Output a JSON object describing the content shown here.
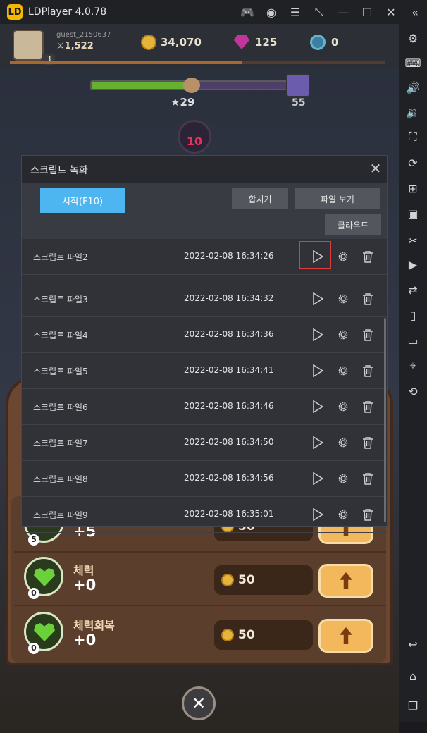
{
  "window": {
    "title": "LDPlayer 4.0.78",
    "logo_text": "LD",
    "titlebar_icons": [
      "gamepad-icon",
      "user-icon",
      "menu-icon",
      "resize-icon",
      "minimize-icon",
      "maximize-icon",
      "close-icon",
      "back-icon"
    ]
  },
  "sidebar": {
    "icons": [
      "settings-icon",
      "keyboard-icon",
      "volume-up-icon",
      "volume-down-icon",
      "screenshot-icon",
      "record-icon",
      "add-app-icon",
      "apk-icon",
      "scissors-icon",
      "video-icon",
      "sync-icon",
      "shake-icon",
      "folder-icon",
      "location-icon",
      "rotate-icon"
    ],
    "bottom_icons": [
      "back-icon",
      "home-icon",
      "recent-apps-icon"
    ]
  },
  "game": {
    "username": "guest_2150637",
    "power": "⚔1,522",
    "level": "3",
    "coins": "34,070",
    "gems": "125",
    "tokens": "0",
    "xp_progress": 0.62,
    "stage_current": "★29",
    "stage_max": "55",
    "stage_progress": 0.46,
    "bomb_count": "10",
    "stats": [
      {
        "name": "",
        "value": "+5",
        "level": "5",
        "cost": "50"
      },
      {
        "name": "체력",
        "value": "+0",
        "level": "0",
        "cost": "50"
      },
      {
        "name": "체력회복",
        "value": "+0",
        "level": "0",
        "cost": "50"
      }
    ]
  },
  "dialog": {
    "title": "스크립트 녹화",
    "start_button": "시작(F10)",
    "merge_button": "합치기",
    "view_file_button": "파일 보기",
    "cloud_button": "클라우드",
    "scripts": [
      {
        "name": "스크립트 파일2",
        "time": "2022-02-08 16:34:26"
      },
      {
        "name": "스크립트 파일3",
        "time": "2022-02-08 16:34:32"
      },
      {
        "name": "스크립트 파일4",
        "time": "2022-02-08 16:34:36"
      },
      {
        "name": "스크립트 파일5",
        "time": "2022-02-08 16:34:41"
      },
      {
        "name": "스크립트 파일6",
        "time": "2022-02-08 16:34:46"
      },
      {
        "name": "스크립트 파일7",
        "time": "2022-02-08 16:34:50"
      },
      {
        "name": "스크립트 파일8",
        "time": "2022-02-08 16:34:56"
      },
      {
        "name": "스크립트 파일9",
        "time": "2022-02-08 16:35:01"
      }
    ]
  }
}
